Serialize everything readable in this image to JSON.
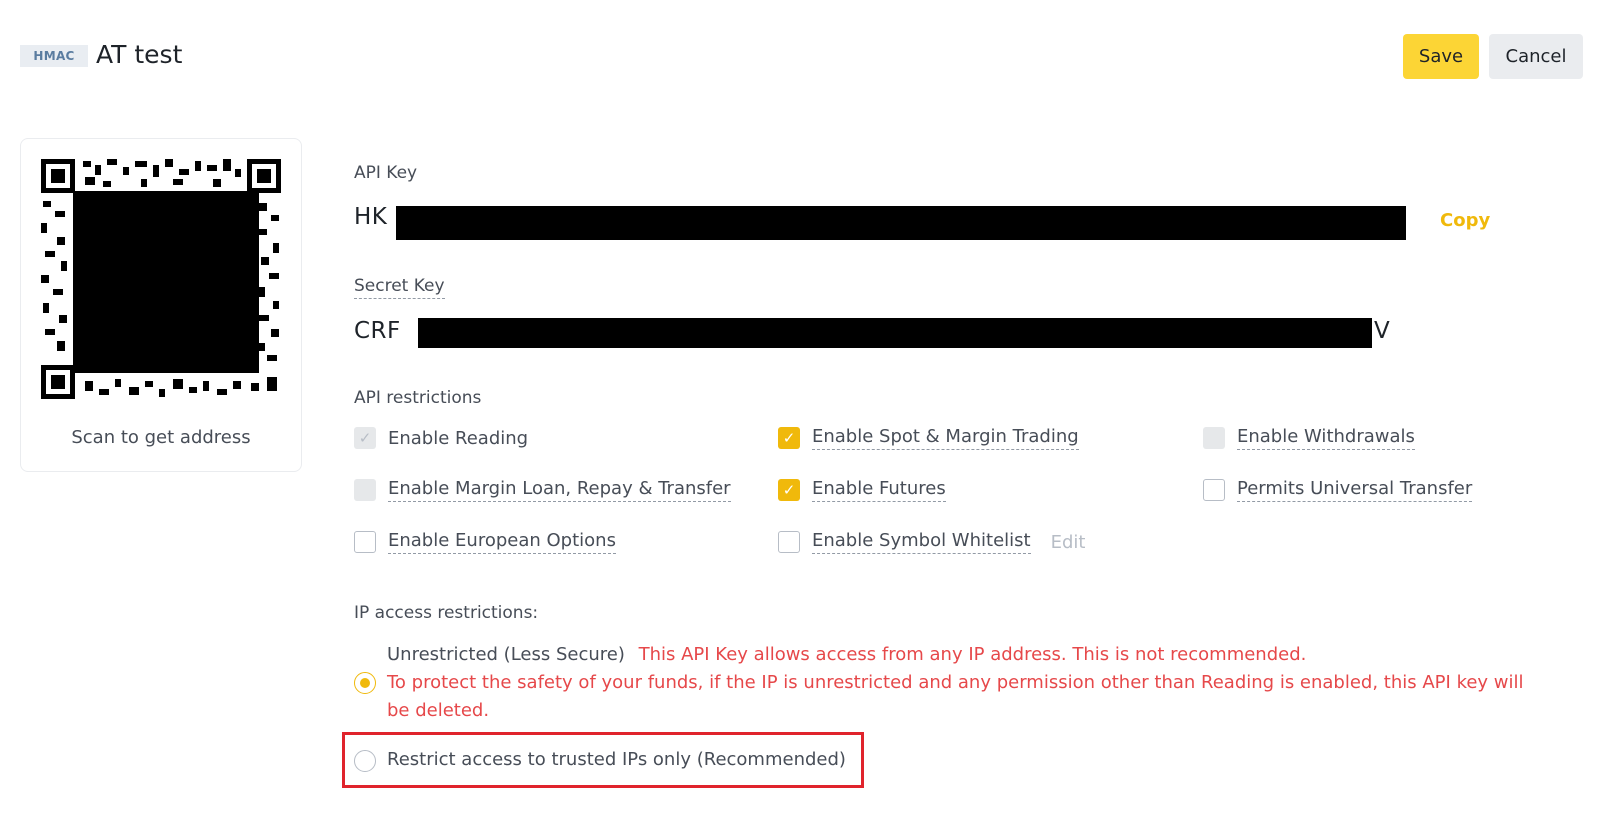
{
  "header": {
    "badge": "HMAC",
    "title": "AT test",
    "save_label": "Save",
    "cancel_label": "Cancel"
  },
  "qr": {
    "caption": "Scan to get address"
  },
  "api_key": {
    "label": "API Key",
    "prefix": "HK",
    "copy_label": "Copy"
  },
  "secret_key": {
    "label": "Secret Key",
    "prefix": "CRF",
    "suffix": "V"
  },
  "restrictions": {
    "label": "API restrictions",
    "items": [
      {
        "label": "Enable Reading",
        "state": "checked-disabled"
      },
      {
        "label": "Enable Spot & Margin Trading",
        "state": "checked"
      },
      {
        "label": "Enable Withdrawals",
        "state": "disabled"
      },
      {
        "label": "Enable Margin Loan, Repay & Transfer",
        "state": "disabled"
      },
      {
        "label": "Enable Futures",
        "state": "checked"
      },
      {
        "label": "Permits Universal Transfer",
        "state": "unchecked"
      },
      {
        "label": "Enable European Options",
        "state": "unchecked"
      },
      {
        "label": "Enable Symbol Whitelist",
        "state": "unchecked",
        "edit_label": "Edit"
      }
    ]
  },
  "ip": {
    "label": "IP access restrictions:",
    "unrestricted_label": "Unrestricted (Less Secure)",
    "unrestricted_warning_1": "This API Key allows access from any IP address. This is not recommended.",
    "unrestricted_warning_2": "To protect the safety of your funds, if the IP is unrestricted and any permission other than Reading is enabled, this API key will be deleted.",
    "restricted_label": "Restrict access to trusted IPs only (Recommended)"
  },
  "colors": {
    "accent": "#f0b90b",
    "warning": "#e6484a",
    "highlight": "#e0232c"
  }
}
